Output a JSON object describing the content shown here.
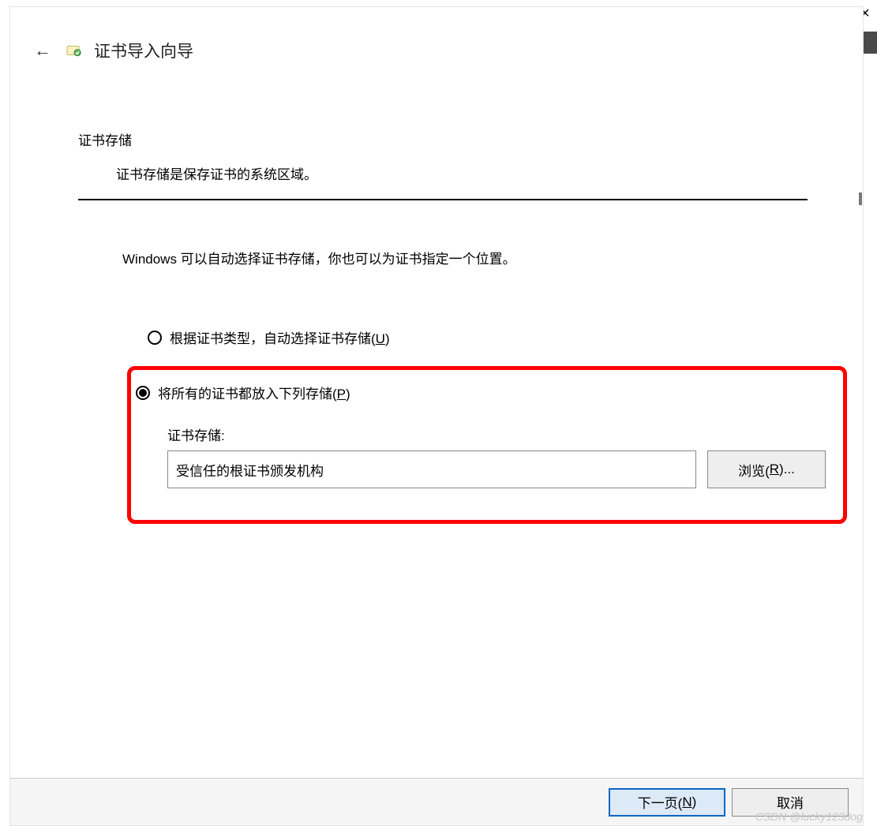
{
  "window": {
    "close_symbol": "×"
  },
  "header": {
    "back_arrow": "←",
    "title": "证书导入向导"
  },
  "section": {
    "title": "证书存储",
    "subtitle": "证书存储是保存证书的系统区域。"
  },
  "instruction": "Windows 可以自动选择证书存储，你也可以为证书指定一个位置。",
  "radios": {
    "auto": {
      "label_pre": "根据证书类型，自动选择证书存储(",
      "hotkey": "U",
      "label_post": ")",
      "selected": false
    },
    "manual": {
      "label_pre": "将所有的证书都放入下列存储(",
      "hotkey": "P",
      "label_post": ")",
      "selected": true
    }
  },
  "store": {
    "label": "证书存储:",
    "value": "受信任的根证书颁发机构",
    "browse_pre": "浏览(",
    "browse_hotkey": "R",
    "browse_post": ")..."
  },
  "footer": {
    "next_pre": "下一页(",
    "next_hotkey": "N",
    "next_post": ")",
    "cancel": "取消"
  },
  "watermark": "CSDN @lucky123dog"
}
